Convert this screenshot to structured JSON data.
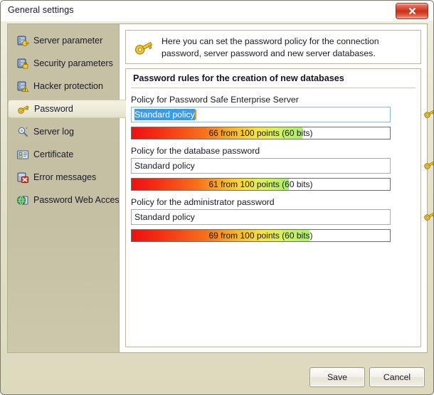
{
  "window": {
    "title": "General settings",
    "close_label": "✖"
  },
  "sidebar": {
    "items": [
      {
        "label": "Server parameter",
        "icon": "server-icon",
        "selected": false
      },
      {
        "label": "Security parameters",
        "icon": "server-lock-icon",
        "selected": false
      },
      {
        "label": "Hacker protection",
        "icon": "server-warning-icon",
        "selected": false
      },
      {
        "label": "Password",
        "icon": "key-icon",
        "selected": true
      },
      {
        "label": "Server log",
        "icon": "magnifier-log-icon",
        "selected": false
      },
      {
        "label": "Certificate",
        "icon": "certificate-icon",
        "selected": false
      },
      {
        "label": "Error messages",
        "icon": "error-icon",
        "selected": false
      },
      {
        "label": "Password Web Access",
        "icon": "globe-icon",
        "selected": false
      }
    ]
  },
  "info": {
    "icon": "key-icon",
    "text": "Here you can set the password policy for the connection password, server password and new server databases."
  },
  "group": {
    "title": "Password rules for the creation of new databases",
    "fields": [
      {
        "label": "Policy for Password Safe Enterprise Server",
        "value": "Standard policy",
        "selected": true,
        "key_icon": "key-icon",
        "strength": {
          "text": "66 from 100 points (60 bits)",
          "points": 66,
          "max_points": 100,
          "bits": 60
        }
      },
      {
        "label": "Policy for the database password",
        "value": "Standard policy",
        "selected": false,
        "key_icon": "key-icon",
        "strength": {
          "text": "61 from 100 points (60 bits)",
          "points": 61,
          "max_points": 100,
          "bits": 60
        }
      },
      {
        "label": "Policy for the administrator password",
        "value": "Standard policy",
        "selected": false,
        "key_icon": "key-icon",
        "strength": {
          "text": "69 from 100 points (60 bits)",
          "points": 69,
          "max_points": 100,
          "bits": 60
        }
      }
    ]
  },
  "footer": {
    "save_label": "Save",
    "cancel_label": "Cancel"
  },
  "colors": {
    "dialog_bg": "#ddd9bd",
    "sidebar_bg": "#c5bfa3",
    "selection_blue": "#3a9bea",
    "caret_orange": "#f0962a",
    "close_red": "#c92f18",
    "strength_start": "#f01010",
    "strength_end": "#a9f06a"
  }
}
